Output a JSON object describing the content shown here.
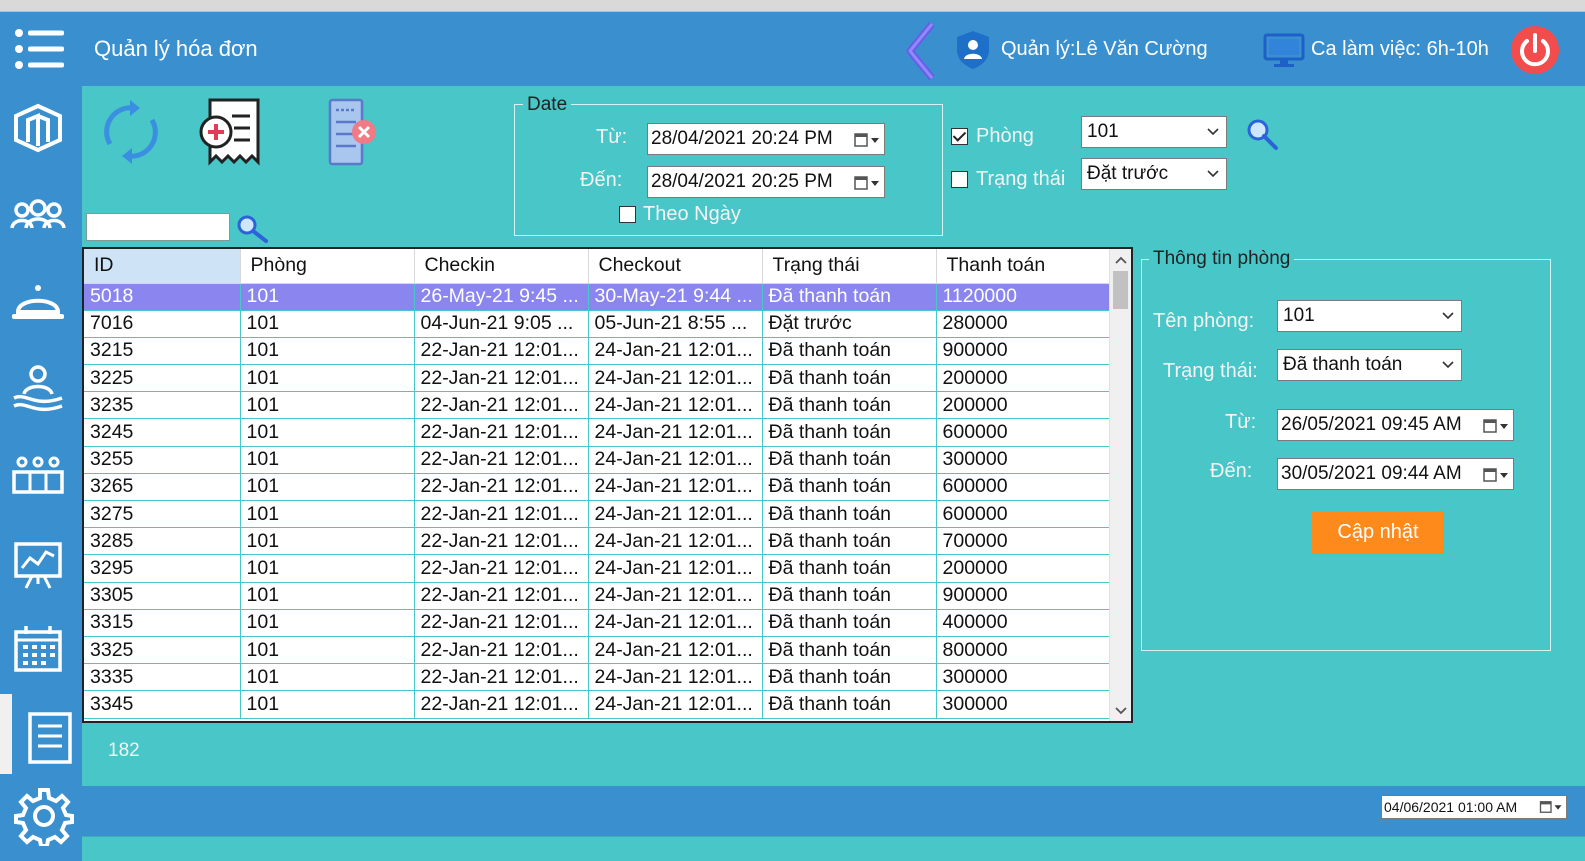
{
  "header": {
    "title": "Quản lý hóa đơn",
    "manager": "Quản lý:Lê Văn Cường",
    "shift": "Ca làm việc: 6h-10h"
  },
  "filters": {
    "date_group_title": "Date",
    "from_label": "Từ:",
    "to_label": "Đến:",
    "from_value": "28/04/2021 20:24 PM",
    "to_value": "28/04/2021 20:25 PM",
    "by_day_label": "Theo Ngày",
    "by_day_checked": false,
    "room_label": "Phòng",
    "room_checked": true,
    "room_value": "101",
    "status_label": "Trạng thái",
    "status_checked": false,
    "status_value": "Đặt trước",
    "search_value": ""
  },
  "grid": {
    "columns": [
      "ID",
      "Phòng",
      "Checkin",
      "Checkout",
      "Trạng thái",
      "Thanh toán"
    ],
    "rows": [
      [
        "5018",
        "101",
        "26-May-21 9:45 ...",
        "30-May-21 9:44 ...",
        "Đã thanh toán",
        "1120000"
      ],
      [
        "7016",
        "101",
        "04-Jun-21 9:05 ...",
        "05-Jun-21 8:55 ...",
        "Đặt trước",
        "280000"
      ],
      [
        "3215",
        "101",
        "22-Jan-21 12:01...",
        "24-Jan-21 12:01...",
        "Đã thanh toán",
        "900000"
      ],
      [
        "3225",
        "101",
        "22-Jan-21 12:01...",
        "24-Jan-21 12:01...",
        "Đã thanh toán",
        "200000"
      ],
      [
        "3235",
        "101",
        "22-Jan-21 12:01...",
        "24-Jan-21 12:01...",
        "Đã thanh toán",
        "200000"
      ],
      [
        "3245",
        "101",
        "22-Jan-21 12:01...",
        "24-Jan-21 12:01...",
        "Đã thanh toán",
        "600000"
      ],
      [
        "3255",
        "101",
        "22-Jan-21 12:01...",
        "24-Jan-21 12:01...",
        "Đã thanh toán",
        "300000"
      ],
      [
        "3265",
        "101",
        "22-Jan-21 12:01...",
        "24-Jan-21 12:01...",
        "Đã thanh toán",
        "600000"
      ],
      [
        "3275",
        "101",
        "22-Jan-21 12:01...",
        "24-Jan-21 12:01...",
        "Đã thanh toán",
        "600000"
      ],
      [
        "3285",
        "101",
        "22-Jan-21 12:01...",
        "24-Jan-21 12:01...",
        "Đã thanh toán",
        "700000"
      ],
      [
        "3295",
        "101",
        "22-Jan-21 12:01...",
        "24-Jan-21 12:01...",
        "Đã thanh toán",
        "200000"
      ],
      [
        "3305",
        "101",
        "22-Jan-21 12:01...",
        "24-Jan-21 12:01...",
        "Đã thanh toán",
        "900000"
      ],
      [
        "3315",
        "101",
        "22-Jan-21 12:01...",
        "24-Jan-21 12:01...",
        "Đã thanh toán",
        "400000"
      ],
      [
        "3325",
        "101",
        "22-Jan-21 12:01...",
        "24-Jan-21 12:01...",
        "Đã thanh toán",
        "800000"
      ],
      [
        "3335",
        "101",
        "22-Jan-21 12:01...",
        "24-Jan-21 12:01...",
        "Đã thanh toán",
        "300000"
      ],
      [
        "3345",
        "101",
        "22-Jan-21 12:01...",
        "24-Jan-21 12:01...",
        "Đã thanh toán",
        "300000"
      ]
    ],
    "selected_row": 0,
    "count": "182"
  },
  "room_info": {
    "title": "Thông tin phòng",
    "name_label": "Tên phòng:",
    "name_value": "101",
    "status_label": "Trạng thái:",
    "status_value": "Đã thanh toán",
    "from_label": "Từ:",
    "from_value": "26/05/2021 09:45 AM",
    "to_label": "Đến:",
    "to_value": "30/05/2021 09:44 AM",
    "update_label": "Cập nhật"
  },
  "footer": {
    "date_value": "04/06/2021 01:00 AM"
  },
  "colors": {
    "header_blue": "#3a90cf",
    "content_teal": "#49c6c8",
    "selected_row": "#8b85f0",
    "update_button": "#ff8a1c",
    "power_red": "#f24c4c"
  },
  "icons": {
    "sidebar": [
      "rooms-icon",
      "customers-icon",
      "service-bell-icon",
      "guest-icon",
      "staff-icon",
      "statistics-icon",
      "calendar-icon",
      "invoice-icon",
      "settings-icon"
    ],
    "toolbar": [
      "refresh-icon",
      "add-invoice-icon",
      "delete-invoice-icon"
    ]
  }
}
